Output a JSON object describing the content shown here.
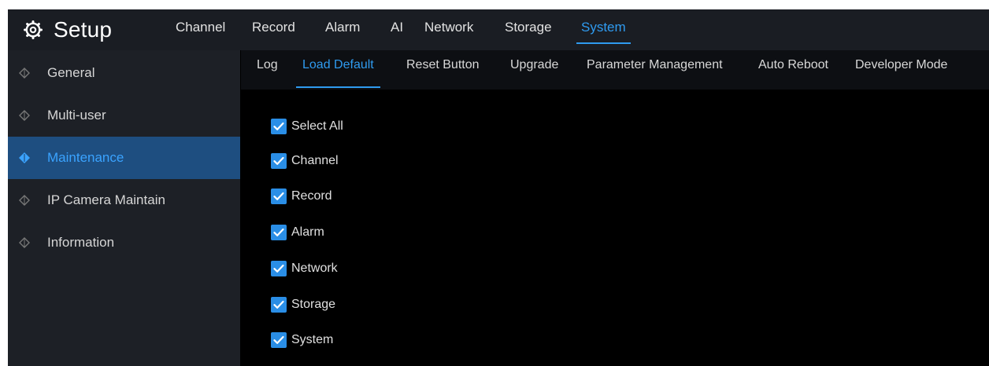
{
  "header": {
    "title": "Setup",
    "tabs": [
      {
        "label": "Channel"
      },
      {
        "label": "Record"
      },
      {
        "label": "Alarm"
      },
      {
        "label": "AI"
      },
      {
        "label": "Network"
      },
      {
        "label": "Storage"
      },
      {
        "label": "System",
        "active": true
      }
    ]
  },
  "sidebar": {
    "items": [
      {
        "label": "General"
      },
      {
        "label": "Multi-user"
      },
      {
        "label": "Maintenance",
        "active": true
      },
      {
        "label": "IP Camera Maintain"
      },
      {
        "label": "Information"
      }
    ]
  },
  "subtabs": [
    {
      "label": "Log"
    },
    {
      "label": "Load Default",
      "active": true
    },
    {
      "label": "Reset Button"
    },
    {
      "label": "Upgrade"
    },
    {
      "label": "Parameter Management"
    },
    {
      "label": "Auto Reboot"
    },
    {
      "label": "Developer Mode"
    }
  ],
  "checklist": [
    {
      "label": "Select All",
      "checked": true
    },
    {
      "label": "Channel",
      "checked": true
    },
    {
      "label": "Record",
      "checked": true
    },
    {
      "label": "Alarm",
      "checked": true
    },
    {
      "label": "Network",
      "checked": true
    },
    {
      "label": "Storage",
      "checked": true
    },
    {
      "label": "System",
      "checked": true
    }
  ],
  "colors": {
    "accent": "#2f9bf0",
    "sidebar_active": "#1e4e80",
    "checkbox": "#2a8ee6"
  },
  "icons": {
    "logo": "gear-icon",
    "sidebar_bullet": "diamond-icon",
    "checkbox": "checkmark-icon"
  }
}
